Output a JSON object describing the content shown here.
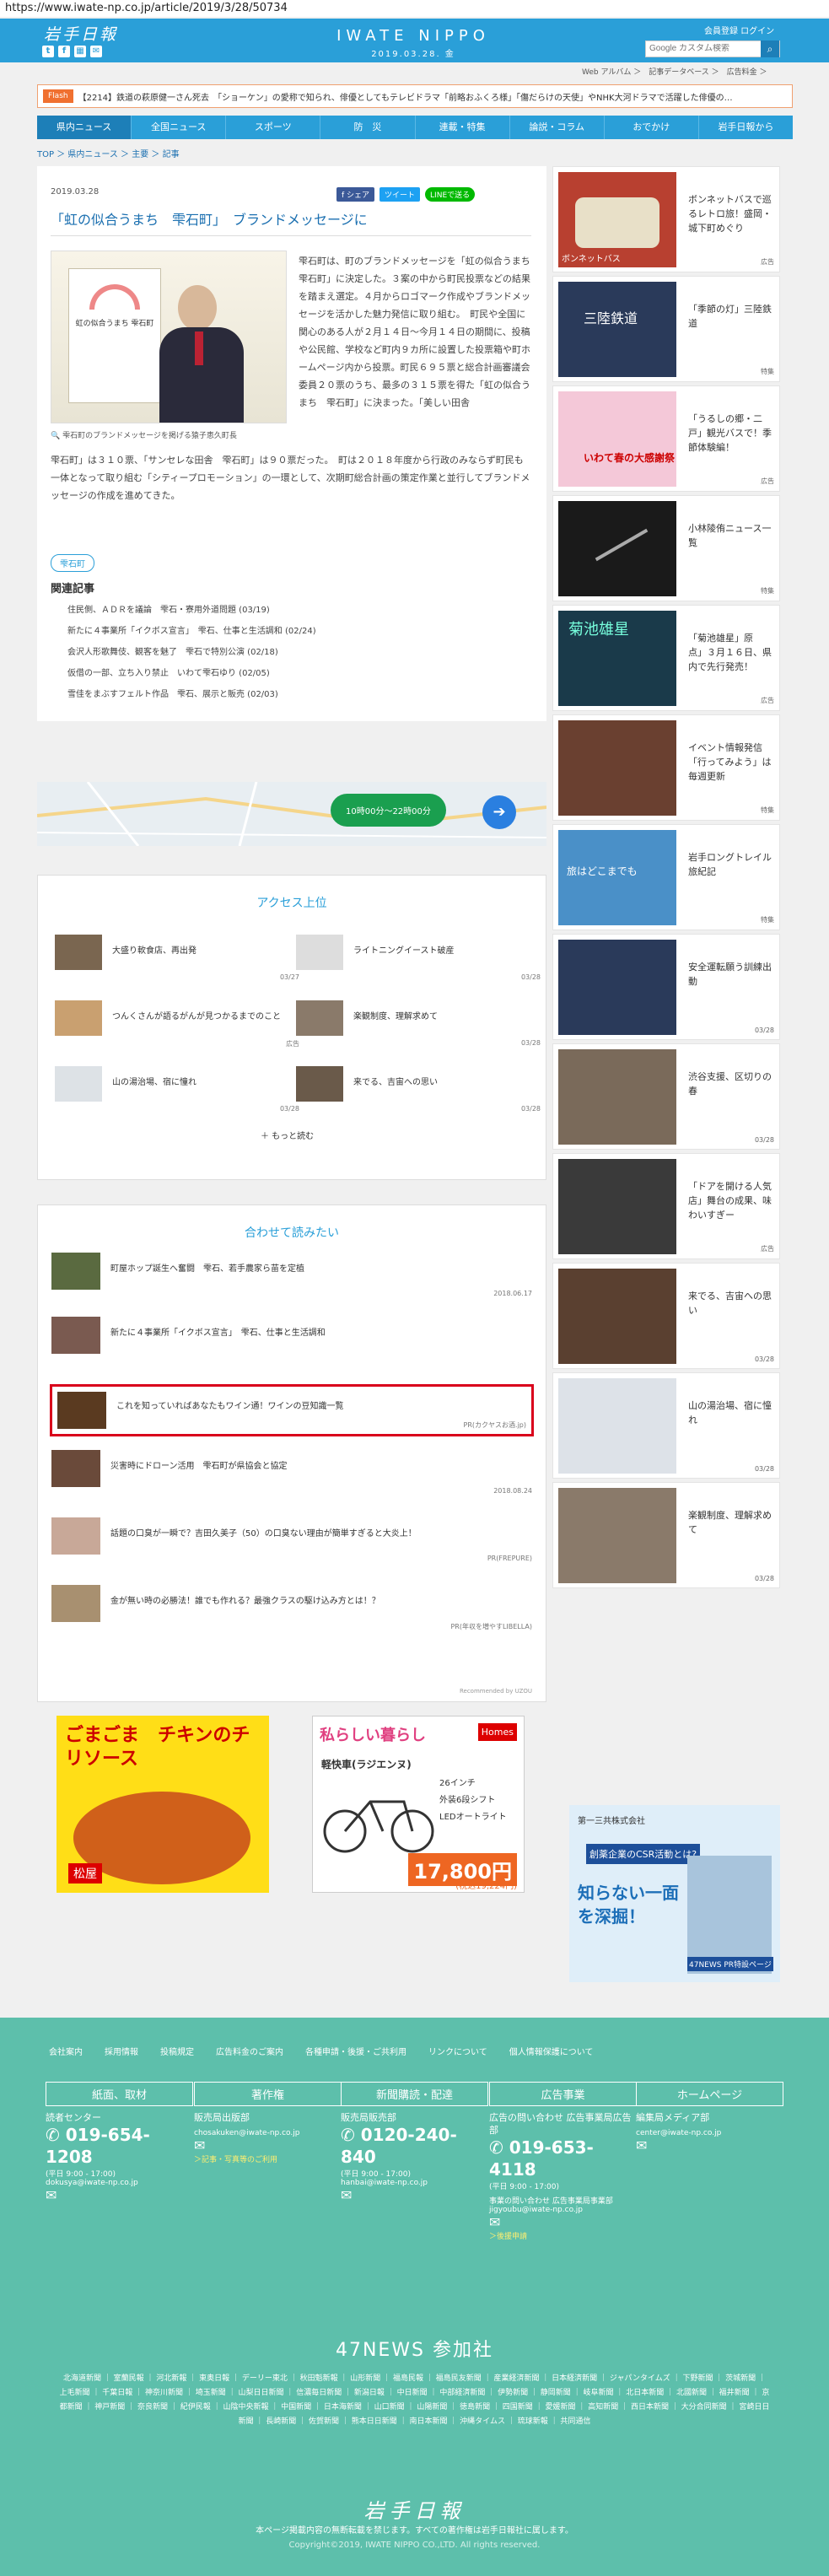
{
  "url": "https://www.iwate-np.co.jp/article/2019/3/28/50734",
  "header": {
    "logo": "岩手日報",
    "brand": "IWATE NIPPO",
    "date": "2019.03.28. 金",
    "links": "会員登録  ログイン",
    "search_placeholder": "Google カスタム検索",
    "util": "Web アルバム ＞　記事データベース ＞　広告料金 ＞"
  },
  "ticker": {
    "badge": "Flash",
    "text": "【2214】鉄道の萩原健一さん死去　「ショーケン」の愛称で知られ、俳優としてもテレビドラマ「前略おふくろ様」「傷だらけの天使」やNHK大河ドラマで活躍した俳優の…"
  },
  "nav": [
    "県内ニュース",
    "全国ニュース",
    "スポーツ",
    "防　災",
    "連載・特集",
    "論説・コラム",
    "おでかけ",
    "岩手日報から"
  ],
  "breadcrumb": "TOP ＞ 県内ニュース ＞ 主要 ＞ 記事",
  "article": {
    "date": "2019.03.28",
    "share_fb": "f シェア",
    "share_tw": "ツイート",
    "share_line": "LINEで送る",
    "title": "「虹の似合うまち　雫石町」　ブランドメッセージに",
    "photo_text": "虹の似合うまち 雫石町",
    "caption": "雫石町のブランドメッセージを掲げる猿子恵久町長",
    "body1": "雫石町は、町のブランドメッセージを「虹の似合うまち　雫石町」に決定した。３案の中から町民投票などの結果を踏まえ選定。４月からロゴマーク作成やブランドメッセージを活かした魅力発信に取り組む。　町民や全国に関心のある人が２月１４日～今月１４日の期間に、投稿や公民館、学校など町内９カ所に設置した投票箱や町ホームページ内から投票。町民６９５票と総合計画審議会委員２０票のうち、最多の３１５票を得た「虹の似合うまち　雫石町」に決まった。「美しい田舎",
    "body2": "雫石町」は３１０票、「サンセレな田舎　雫石町」は９０票だった。　町は２０１８年度から行政のみならず町民も一体となって取り組む「シティープロモーション」の一環として、次期町総合計画の策定作業と並行してブランドメッセージの作成を進めてきた。",
    "tag": "雫石町",
    "related_h": "関連記事",
    "related": [
      "住民側、ＡＤＲを議論　雫石・寮用外道問題 (03/19)",
      "新たに４事業所「イクボス宣言」　雫石、仕事と生活調和 (02/24)",
      "会沢人形歌舞伎、観客を魅了　雫石で特別公演 (02/18)",
      "仮借の一部、立ち入り禁止　いわて雫石ゆり (02/05)",
      "雪佳をまぶすフェルト作品　雫石、展示と販売 (02/03)"
    ]
  },
  "map": {
    "btn": "10時00分～22時00分"
  },
  "access": {
    "title": "アクセス上位",
    "items": [
      {
        "t": "大盛り軟食店、再出発",
        "d": "03/27"
      },
      {
        "t": "ライトニングイースト破産",
        "d": "03/28"
      },
      {
        "t": "つんくさんが語るがんが見つかるまでのこと",
        "d": "広告"
      },
      {
        "t": "楽観制度、理解求めて",
        "d": "03/28"
      },
      {
        "t": "山の湯治場、宿に憧れ",
        "d": "03/28"
      },
      {
        "t": "来でる、吉宙への思い",
        "d": "03/28"
      }
    ],
    "more": "＋ もっと読む"
  },
  "reco": {
    "title": "合わせて読みたい",
    "items": [
      {
        "t": "町屋ホップ誕生へ奮闘　雫石、若手農家ら苗を定植",
        "d": "2018.06.17"
      },
      {
        "t": "新たに４事業所「イクボス宣言」　雫石、仕事と生活調和",
        "d": ""
      },
      {
        "t": "これを知っていればあなたもワイン通！ワインの豆知識一覧",
        "d": "PR(カクヤスお酒.jp)"
      },
      {
        "t": "災害時にドローン活用　雫石町が県協会と協定",
        "d": "2018.08.24"
      },
      {
        "t": "話題の口臭が一瞬で？吉田久美子（50）の口臭ない理由が簡単すぎると大炎上！",
        "d": "PR(FREPURE)"
      },
      {
        "t": "金が無い時の必勝法！誰でも作れる？最強クラスの駆け込み方とは！？",
        "d": "PR(年収を増やすLIBELLA)"
      }
    ],
    "footer": "Recommended by UZOU"
  },
  "side": [
    {
      "t": "ボンネットバスで巡るレトロ旅！盛岡・城下町めぐり",
      "d": "広告"
    },
    {
      "t": "「季節の灯」三陸鉄道",
      "d": "特集"
    },
    {
      "t": "「うるしの郷・二戸」観光バスで！季節体験編！",
      "d": "広告"
    },
    {
      "t": "小林陵侑ニュース一覧",
      "d": "特集"
    },
    {
      "t": "「菊池雄星」原　点」３月１６日、県内で先行発売！",
      "d": "広告"
    },
    {
      "t": "イベント情報発信「行ってみよう」は毎週更新",
      "d": "特集"
    },
    {
      "t": "岩手ロングトレイル旅紀記",
      "d": "特集"
    },
    {
      "t": "安全運転願う訓練出動",
      "d": "03/28"
    },
    {
      "t": "渋谷支援、区切りの春",
      "d": "03/28"
    },
    {
      "t": "「ドアを開ける人気店」舞台の成果、味わいすぎー",
      "d": "広告"
    },
    {
      "t": "来でる、吉宙への思い",
      "d": "03/28"
    },
    {
      "t": "山の湯治場、宿に憧れ",
      "d": "03/28"
    },
    {
      "t": "楽観制度、理解求めて",
      "d": "03/28"
    }
  ],
  "side_labels": [
    "ボンネットバス",
    "三陸鉄道",
    "いわて春の大感謝祭",
    "",
    "菊池雄星",
    "",
    "旅はどこまでも",
    "",
    "",
    "",
    "",
    "",
    ""
  ],
  "ads": {
    "ad1_title": "ごまごま　チキンのチリソース",
    "ad1_brand": "松屋",
    "ad2_title": "私らしい暮らし",
    "ad2_store": "Homes",
    "ad2_bike": "軽快車(ラジエンヌ)",
    "ad2_spec1": "26インチ",
    "ad2_spec2": "外装6段シフト",
    "ad2_spec3": "LEDオートライト",
    "ad2_price": "17,800円",
    "ad2_tax": "(税込19,224円)",
    "ad3_bank": "第一三共株式会社",
    "ad3_q": "創薬企業のCSR活動とは?",
    "ad3_title": "知らない一面を深掘！",
    "ad3_src": "47NEWS PR特設ページ"
  },
  "footer": {
    "links": [
      "会社案内",
      "採用情報",
      "投稿規定",
      "広告料金のご案内",
      "各種申請・後援・ご共利用",
      "リンクについて",
      "個人情報保護について"
    ],
    "cols": [
      {
        "h": "紙面、取材",
        "sub": "読者センター",
        "phone": "019-654-1208",
        "hours": "(平日 9:00 - 17:00)",
        "mail": "dokusya@iwate-np.co.jp"
      },
      {
        "h": "著作権",
        "sub": "販売局出版部",
        "phone": "",
        "hours": "",
        "mail": "chosakuken@iwate-np.co.jp",
        "extra": "＞記事・写真等のご利用"
      },
      {
        "h": "新聞購読・配達",
        "sub": "販売局販売部",
        "phone": "0120-240-840",
        "hours": "(平日 9:00 - 17:00)",
        "mail": "hanbai@iwate-np.co.jp"
      },
      {
        "h": "広告事業",
        "sub": "広告の問い合わせ 広告事業局広告部",
        "phone": "019-653-4118",
        "hours": "(平日 9:00 - 17:00)",
        "mail": "事業の問い合わせ 広告事業局事業部 jigyoubu@iwate-np.co.jp",
        "extra": "＞後援申請"
      },
      {
        "h": "ホームページ",
        "sub": "編集局メディア部",
        "phone": "",
        "hours": "",
        "mail": "center@iwate-np.co.jp"
      }
    ],
    "p47": "47NEWS 参加社",
    "papers": "北海道新聞 ｜ 室蘭民報 ｜ 河北新報 ｜ 東奥日報 ｜ デーリー東北 ｜ 秋田魁新報 ｜ 山形新聞 ｜ 福島民報 ｜ 福島民友新聞 ｜ 産業経済新聞 ｜ 日本経済新聞 ｜ ジャパンタイムズ ｜ 下野新聞 ｜ 茨城新聞 ｜ 上毛新聞 ｜ 千葉日報 ｜ 神奈川新聞 ｜ 埼玉新聞 ｜ 山梨日日新聞 ｜ 信濃毎日新聞 ｜ 新潟日報 ｜ 中日新聞 ｜ 中部経済新聞 ｜ 伊勢新聞 ｜ 静岡新聞 ｜ 岐阜新聞 ｜ 北日本新聞 ｜ 北國新聞 ｜ 福井新聞 ｜ 京都新聞 ｜ 神戸新聞 ｜ 奈良新聞 ｜ 紀伊民報 ｜ 山陰中央新報 ｜ 中国新聞 ｜ 日本海新聞 ｜ 山口新聞 ｜ 山陽新聞 ｜ 徳島新聞 ｜ 四国新聞 ｜ 愛媛新聞 ｜ 高知新聞 ｜ 西日本新聞 ｜ 大分合同新聞 ｜ 宮崎日日新聞 ｜ 長崎新聞 ｜ 佐賀新聞 ｜ 熊本日日新聞 ｜ 南日本新聞 ｜ 沖縄タイムス ｜ 琉球新報 ｜ 共同通信",
    "logo": "岩手日報",
    "copy1": "本ページ掲載内容の無断転載を禁じます。すべての著作権は岩手日報社に属します。",
    "copy2": "Copyright©2019, IWATE NIPPO CO.,LTD. All rights reserved."
  }
}
